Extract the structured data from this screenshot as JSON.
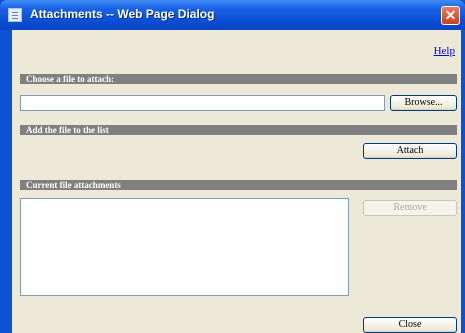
{
  "window": {
    "title": "Attachments -- Web Page Dialog",
    "close_glyph": "✕"
  },
  "help": {
    "label": "Help"
  },
  "sections": {
    "choose": "Choose a file to attach:",
    "add": "Add the file to the list",
    "current": "Current file attachments"
  },
  "file_input": {
    "value": "",
    "placeholder": ""
  },
  "buttons": {
    "browse": "Browse...",
    "attach": "Attach",
    "remove": "Remove",
    "close": "Close"
  },
  "attachments": [],
  "colors": {
    "title_bar": "#0a52d6",
    "section_header": "#808080",
    "dialog_bg": "#ece9d8",
    "close_button": "#d2552f"
  }
}
